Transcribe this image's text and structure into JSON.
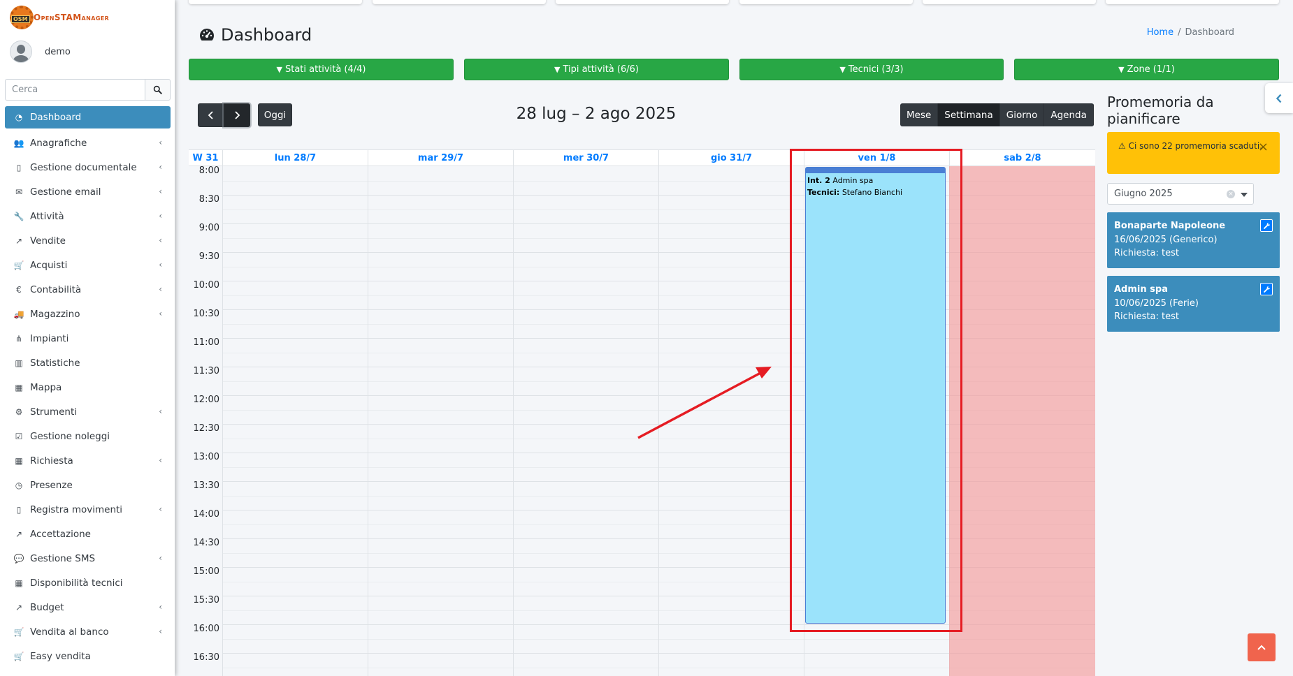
{
  "app": {
    "logo_text": "OpenSTAManager",
    "logo_badge": "OSM",
    "user_name": "demo"
  },
  "search": {
    "placeholder": "Cerca"
  },
  "sidebar": {
    "items": [
      {
        "label": "Dashboard",
        "icon": "dashboard-icon",
        "arrow": false
      },
      {
        "label": "Anagrafiche",
        "icon": "users-icon",
        "arrow": true
      },
      {
        "label": "Gestione documentale",
        "icon": "file-icon",
        "arrow": true
      },
      {
        "label": "Gestione email",
        "icon": "envelope-icon",
        "arrow": true
      },
      {
        "label": "Attività",
        "icon": "wrench-icon",
        "arrow": true
      },
      {
        "label": "Vendite",
        "icon": "line-chart-icon",
        "arrow": true
      },
      {
        "label": "Acquisti",
        "icon": "cart-icon",
        "arrow": true
      },
      {
        "label": "Contabilità",
        "icon": "euro-icon",
        "arrow": true
      },
      {
        "label": "Magazzino",
        "icon": "truck-icon",
        "arrow": true
      },
      {
        "label": "Impianti",
        "icon": "sitemap-icon",
        "arrow": false
      },
      {
        "label": "Statistiche",
        "icon": "bar-chart-icon",
        "arrow": false
      },
      {
        "label": "Mappa",
        "icon": "map-icon",
        "arrow": false
      },
      {
        "label": "Strumenti",
        "icon": "cog-icon",
        "arrow": true
      },
      {
        "label": "Gestione noleggi",
        "icon": "calendar-check-icon",
        "arrow": false
      },
      {
        "label": "Richiesta",
        "icon": "calendar-icon",
        "arrow": true
      },
      {
        "label": "Presenze",
        "icon": "clock-icon",
        "arrow": false
      },
      {
        "label": "Registra movimenti",
        "icon": "file-icon",
        "arrow": true
      },
      {
        "label": "Accettazione",
        "icon": "external-link-icon",
        "arrow": false
      },
      {
        "label": "Gestione SMS",
        "icon": "comment-icon",
        "arrow": true
      },
      {
        "label": "Disponibilità tecnici",
        "icon": "calendar-icon",
        "arrow": false
      },
      {
        "label": "Budget",
        "icon": "line-chart-icon",
        "arrow": true
      },
      {
        "label": "Vendita al banco",
        "icon": "cart-icon",
        "arrow": true
      },
      {
        "label": "Easy vendita",
        "icon": "cart-icon",
        "arrow": false
      }
    ]
  },
  "header": {
    "title": "Dashboard",
    "breadcrumb_home": "Home",
    "breadcrumb_current": "Dashboard"
  },
  "filters": [
    "Stati attività (4/4)",
    "Tipi attività (6/6)",
    "Tecnici (3/3)",
    "Zone (1/1)"
  ],
  "calendar": {
    "today_label": "Oggi",
    "range_title": "28 lug – 2 ago 2025",
    "views": [
      "Mese",
      "Settimana",
      "Giorno",
      "Agenda"
    ],
    "active_view": "Settimana",
    "week_label": "W 31",
    "days": [
      "lun 28/7",
      "mar 29/7",
      "mer 30/7",
      "gio 31/7",
      "ven 1/8",
      "sab 2/8"
    ],
    "times": [
      "8:00",
      "8:30",
      "9:00",
      "9:30",
      "10:00",
      "10:30",
      "11:00",
      "11:30",
      "12:00",
      "12:30",
      "13:00",
      "13:30",
      "14:00",
      "14:30",
      "15:00",
      "15:30",
      "16:00",
      "16:30"
    ],
    "event": {
      "title_prefix": "Int. 2",
      "title": "Admin spa",
      "tech_label": "Tecnici:",
      "tech": "Stefano Bianchi",
      "color": "#9be3fb"
    }
  },
  "reminders": {
    "title": "Promemoria da pianificare",
    "alert": "Ci sono 22 promemoria scaduti.",
    "month": "Giugno 2025",
    "cards": [
      {
        "name": "Bonaparte Napoleone",
        "date": "16/06/2025 (Generico)",
        "request": "Richiesta: test"
      },
      {
        "name": "Admin spa",
        "date": "10/06/2025 (Ferie)",
        "request": "Richiesta: test"
      }
    ]
  },
  "colors": {
    "accent": "#3c8dbc",
    "filter_green": "#28a745",
    "highlight_red": "#e51c23",
    "weekend": "#f49696",
    "warning": "#ffc107"
  }
}
